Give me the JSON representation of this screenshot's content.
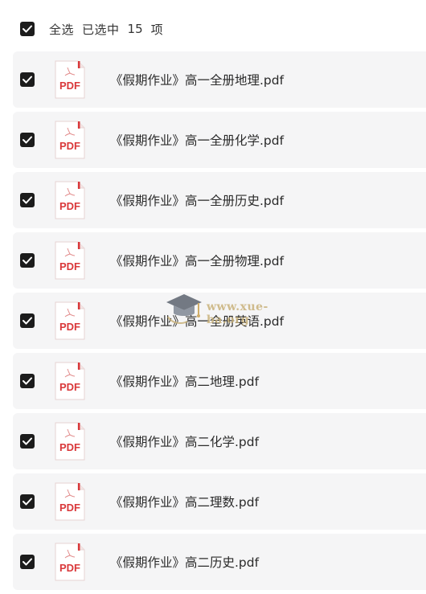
{
  "header": {
    "select_all_label": "全选",
    "selected_label": "已选中",
    "selected_count": "15",
    "unit_label": "项"
  },
  "files": [
    {
      "name": "《假期作业》高一全册地理.pdf",
      "type": "PDF",
      "checked": true
    },
    {
      "name": "《假期作业》高一全册化学.pdf",
      "type": "PDF",
      "checked": true
    },
    {
      "name": "《假期作业》高一全册历史.pdf",
      "type": "PDF",
      "checked": true
    },
    {
      "name": "《假期作业》高一全册物理.pdf",
      "type": "PDF",
      "checked": true
    },
    {
      "name": "《假期作业》高一全册英语.pdf",
      "type": "PDF",
      "checked": true
    },
    {
      "name": "《假期作业》高二地理.pdf",
      "type": "PDF",
      "checked": true
    },
    {
      "name": "《假期作业》高二化学.pdf",
      "type": "PDF",
      "checked": true
    },
    {
      "name": "《假期作业》高二理数.pdf",
      "type": "PDF",
      "checked": true
    },
    {
      "name": "《假期作业》高二历史.pdf",
      "type": "PDF",
      "checked": true
    }
  ],
  "watermark": {
    "text": "www.xue-ba.org"
  },
  "colors": {
    "checkbox": "#1c1c1c",
    "row_background": "#f5f5f6",
    "pdf_red": "#d9383a"
  },
  "icons": {
    "checkbox": "checkmark-icon",
    "file": "pdf-file-icon",
    "watermark_logo": "graduation-cap-icon"
  }
}
